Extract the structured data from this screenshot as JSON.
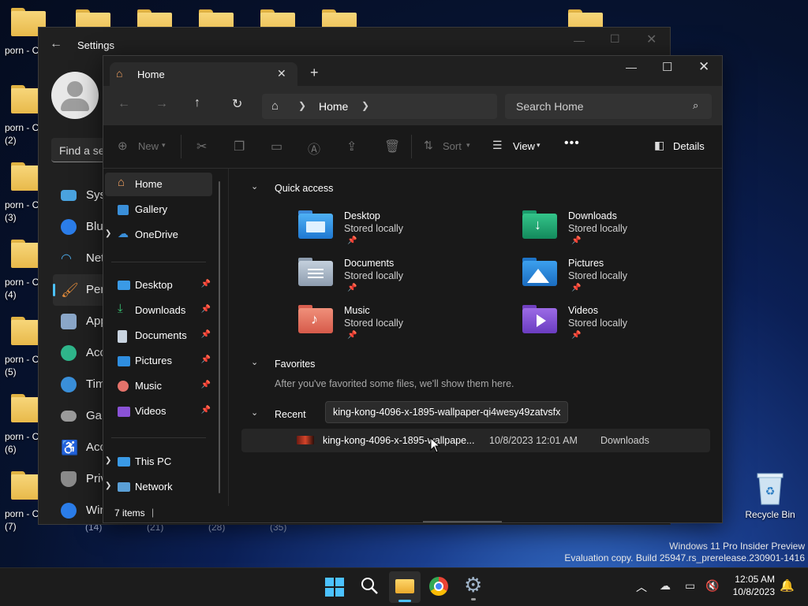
{
  "desktop": {
    "icon_labels": [
      "porn - C",
      "porn - C\n(2)",
      "porn - C\n(3)",
      "porn - C\n(4)",
      "porn - C\n(5)",
      "porn - C\n(6)",
      "porn - C\n(7)"
    ],
    "bottom_counts": [
      "(14)",
      "(21)",
      "(28)",
      "(35)"
    ],
    "recycle_bin": "Recycle Bin",
    "watermark_line1": "Windows 11 Pro Insider Preview",
    "watermark_line2": "Evaluation copy. Build 25947.rs_prerelease.230901-1416"
  },
  "settings": {
    "title": "Settings",
    "search_placeholder": "Find a se",
    "nav": [
      "Syst",
      "Blue",
      "Netw",
      "Pers",
      "Apps",
      "Acco",
      "Time",
      "Gam",
      "Acce",
      "Priv",
      "Win"
    ]
  },
  "explorer": {
    "tab_title": "Home",
    "breadcrumb_current": "Home",
    "search_placeholder": "Search Home",
    "toolbar": {
      "new": "New",
      "sort": "Sort",
      "view": "View",
      "details": "Details"
    },
    "sidebar": {
      "top": [
        "Home",
        "Gallery",
        "OneDrive"
      ],
      "pinned": [
        "Desktop",
        "Downloads",
        "Documents",
        "Pictures",
        "Music",
        "Videos"
      ],
      "bottom": [
        "This PC",
        "Network"
      ]
    },
    "quick_access_label": "Quick access",
    "quick_access": [
      {
        "name": "Desktop",
        "sub": "Stored locally"
      },
      {
        "name": "Downloads",
        "sub": "Stored locally"
      },
      {
        "name": "Documents",
        "sub": "Stored locally"
      },
      {
        "name": "Pictures",
        "sub": "Stored locally"
      },
      {
        "name": "Music",
        "sub": "Stored locally"
      },
      {
        "name": "Videos",
        "sub": "Stored locally"
      }
    ],
    "favorites_label": "Favorites",
    "favorites_empty": "After you've favorited some files, we'll show them here.",
    "recent_label": "Recent",
    "tooltip": "king-kong-4096-x-1895-wallpaper-qi4wesy49zatvsfx",
    "recent_row": {
      "name": "king-kong-4096-x-1895-wallpape...",
      "date": "10/8/2023 12:01 AM",
      "location": "Downloads"
    },
    "status": "7 items"
  },
  "taskbar": {
    "time": "12:05 AM",
    "date": "10/8/2023"
  },
  "colors": {
    "accent": "#4cc2ff",
    "folder": "#f0c75e",
    "window_bg": "#191919"
  }
}
